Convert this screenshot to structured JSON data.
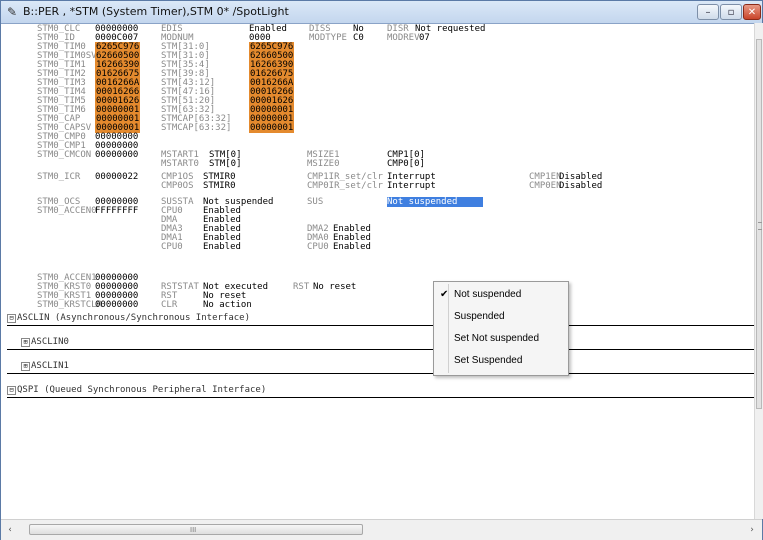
{
  "window": {
    "title": "B::PER , *STM (System Timer),STM 0* /SpotLight",
    "title_icon": "pencil-icon",
    "buttons": {
      "minimize": "–",
      "maximize": "▫",
      "close": "✕"
    }
  },
  "registers": [
    {
      "name": "STM0_CLC",
      "value": "00000000",
      "hl": false
    },
    {
      "name": "STM0_ID",
      "value": "0000C007",
      "hl": false
    },
    {
      "name": "STM0_TIM0",
      "value": "6265C976",
      "hl": true
    },
    {
      "name": "STM0_TIM0SV",
      "value": "62660500",
      "hl": true
    },
    {
      "name": "STM0_TIM1",
      "value": "16266390",
      "hl": true
    },
    {
      "name": "STM0_TIM2",
      "value": "01626675",
      "hl": true
    },
    {
      "name": "STM0_TIM3",
      "value": "0016266A",
      "hl": true
    },
    {
      "name": "STM0_TIM4",
      "value": "00016266",
      "hl": true
    },
    {
      "name": "STM0_TIM5",
      "value": "00001626",
      "hl": true
    },
    {
      "name": "STM0_TIM6",
      "value": "00000001",
      "hl": true
    },
    {
      "name": "STM0_CAP",
      "value": "00000001",
      "hl": true
    },
    {
      "name": "STM0_CAPSV",
      "value": "00000001",
      "hl": true
    },
    {
      "name": "STM0_CMP0",
      "value": "00000000",
      "hl": false
    },
    {
      "name": "STM0_CMP1",
      "value": "00000000",
      "hl": false
    },
    {
      "name": "STM0_CMCON",
      "value": "00000000",
      "hl": false
    },
    {
      "name": "STM0_ICR",
      "value": "00000022",
      "hl": false
    },
    {
      "name": "STM0_OCS",
      "value": "00000000",
      "hl": false
    },
    {
      "name": "STM0_ACCEN0",
      "value": "FFFFFFFF",
      "hl": false
    },
    {
      "name": "STM0_ACCEN1",
      "value": "00000000",
      "hl": false
    },
    {
      "name": "STM0_KRST0",
      "value": "00000000",
      "hl": false
    },
    {
      "name": "STM0_KRST1",
      "value": "00000000",
      "hl": false
    },
    {
      "name": "STM0_KRSTCLR",
      "value": "00000000",
      "hl": false
    }
  ],
  "fields": {
    "clc_edis": "EDIS",
    "clc_edis_v": "Enabled",
    "clc_diss": "DISS",
    "clc_diss_v": "No",
    "clc_disr": "DISR",
    "clc_disr_v": "Not requested",
    "id_modnum": "MODNUM",
    "id_modnum_v": "0000",
    "id_modtype": "MODTYPE",
    "id_modtype_v": "C0",
    "id_modrev": "MODREV",
    "id_modrev_v": "07",
    "stm_0": "STM[31:0]",
    "stm_0_v": "6265C976",
    "stmsv": "STM[31:0]",
    "stmsv_v": "62660500",
    "stm_1": "STM[35:4]",
    "stm_1_v": "16266390",
    "stm_2": "STM[39:8]",
    "stm_2_v": "01626675",
    "stm_3": "STM[43:12]",
    "stm_3_v": "0016266A",
    "stm_4": "STM[47:16]",
    "stm_4_v": "00016266",
    "stm_5": "STM[51:20]",
    "stm_5_v": "00001626",
    "stm_6": "STM[63:32]",
    "stm_6_v": "00000001",
    "cap": "STMCAP[63:32]",
    "cap_v": "00000001",
    "capsv": "STMCAP[63:32]",
    "capsv_v": "00000001",
    "mstart1": "MSTART1",
    "mstart1_v": "STM[0]",
    "msize1": "MSIZE1",
    "msize1_v": "CMP1[0]",
    "mstart0": "MSTART0",
    "mstart0_v": "STM[0]",
    "msize0": "MSIZE0",
    "msize0_v": "CMP0[0]",
    "cmp1os": "CMP1OS",
    "cmp1os_v": "STMIR0",
    "cmp1ir": "CMP1IR_set/clr",
    "cmp1ir_v": "Interrupt",
    "cmp1en": "CMP1EN",
    "cmp1en_v": "Disabled",
    "cmp0os": "CMP0OS",
    "cmp0os_v": "STMIR0",
    "cmp0ir": "CMP0IR_set/clr",
    "cmp0ir_v": "Interrupt",
    "cmp0en": "CMP0EN",
    "cmp0en_v": "Disabled",
    "sussta": "SUSSTA",
    "sussta_v": "Not suspended",
    "sus": "SUS",
    "sus_v": "Not suspended",
    "acc_cpu0": "CPU0",
    "acc_cpu0_v": "Enabled",
    "acc_dma": "DMA",
    "acc_dma_v": "Enabled",
    "acc_dma3": "DMA3",
    "acc_dma3_v": "Enabled",
    "acc_dma2": "DMA2",
    "acc_dma2_v": "Enabled",
    "acc_dma1": "DMA1",
    "acc_dma1_v": "Enabled",
    "acc_dma0": "DMA0",
    "acc_dma0_v": "Enabled",
    "acc_cpu0b": "CPU0",
    "acc_cpu0b_v": "Enabled",
    "acc_cpu0c": "CPU0",
    "acc_cpu0c_v": "Enabled",
    "rststat": "RSTSTAT",
    "rststat_v": "Not executed",
    "rst": "RST",
    "rst_v": "No reset",
    "krst1_rst": "RST",
    "krst1_rst_v": "No reset",
    "krstclr_clr": "CLR",
    "krstclr_clr_v": "No action"
  },
  "popup": {
    "items": [
      "Not suspended",
      "Suspended",
      "Set Not suspended",
      "Set Suspended"
    ],
    "checked": "Not suspended"
  },
  "sections": [
    {
      "label": "ASCLIN (Asynchronous/Synchronous Interface)",
      "expander": "⊟"
    },
    {
      "label": "ASCLIN0",
      "expander": "⊞"
    },
    {
      "label": "ASCLIN1",
      "expander": "⊞"
    },
    {
      "label": "QSPI (Queued Synchronous Peripheral Interface)",
      "expander": "⊟"
    }
  ],
  "scroll": {
    "left": "‹",
    "right": "›",
    "grip": "III"
  }
}
